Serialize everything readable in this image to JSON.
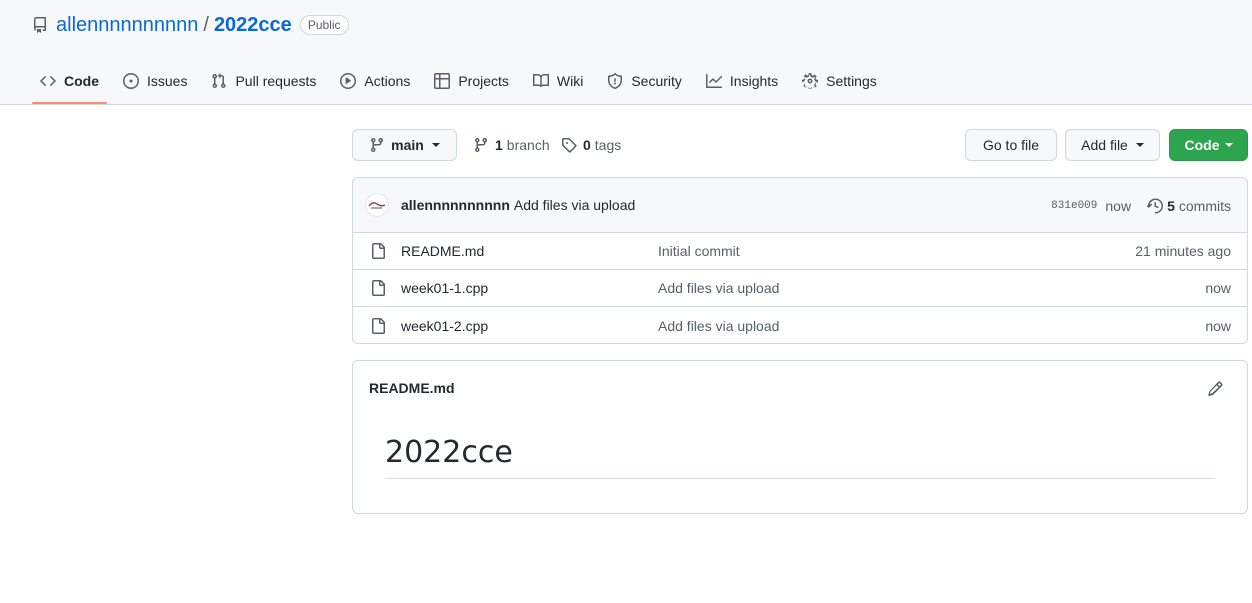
{
  "repo": {
    "owner": "allennnnnnnnnn",
    "separator": "/",
    "name": "2022cce",
    "visibility": "Public"
  },
  "tabs": [
    {
      "label": "Code",
      "icon": "code-icon",
      "selected": true
    },
    {
      "label": "Issues",
      "icon": "issue-icon"
    },
    {
      "label": "Pull requests",
      "icon": "pull-request-icon"
    },
    {
      "label": "Actions",
      "icon": "play-icon"
    },
    {
      "label": "Projects",
      "icon": "table-icon"
    },
    {
      "label": "Wiki",
      "icon": "book-icon"
    },
    {
      "label": "Security",
      "icon": "shield-icon"
    },
    {
      "label": "Insights",
      "icon": "graph-icon"
    },
    {
      "label": "Settings",
      "icon": "gear-icon"
    }
  ],
  "toolbar": {
    "branch": "main",
    "branch_count": "1",
    "branch_label": "branch",
    "tag_count": "0",
    "tag_label": "tags",
    "goto_file": "Go to file",
    "add_file": "Add file",
    "code": "Code"
  },
  "latest_commit": {
    "author": "allennnnnnnnnn",
    "message": "Add files via upload",
    "sha": "831e009",
    "when": "now",
    "commit_count": "5",
    "commits_label": "commits"
  },
  "files": [
    {
      "name": "README.md",
      "message": "Initial commit",
      "age": "21 minutes ago"
    },
    {
      "name": "week01-1.cpp",
      "message": "Add files via upload",
      "age": "now"
    },
    {
      "name": "week01-2.cpp",
      "message": "Add files via upload",
      "age": "now"
    }
  ],
  "readme": {
    "filename": "README.md",
    "heading": "2022cce"
  },
  "colors": {
    "accent": "#0969da",
    "primary_button": "#2da44e",
    "tab_underline": "#fd8c73"
  }
}
